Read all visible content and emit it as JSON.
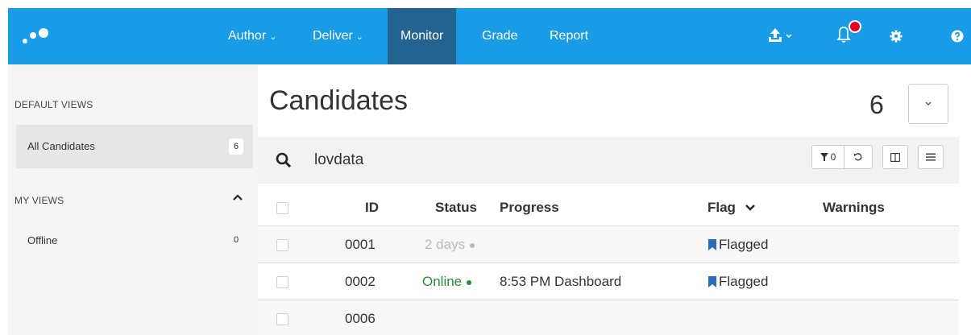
{
  "colors": {
    "brand": "#1a9be6",
    "nav_active": "#24628f",
    "notification": "#e4002b",
    "online": "#2e8b3a",
    "offline_dot": "#bbbbbb",
    "flag": "#2a6ebb"
  },
  "nav": {
    "logo_icon": "dots-logo-icon",
    "items": [
      {
        "label": "Author",
        "has_dropdown": true
      },
      {
        "label": "Deliver",
        "has_dropdown": true
      },
      {
        "label": "Monitor",
        "active": true
      },
      {
        "label": "Grade"
      },
      {
        "label": "Report"
      }
    ],
    "icons": [
      "upload-icon",
      "bell-icon",
      "gear-icon",
      "help-icon"
    ]
  },
  "sidebar": {
    "default_views_heading": "DEFAULT VIEWS",
    "default_views": [
      {
        "label": "All Candidates",
        "count": "6",
        "selected": true
      }
    ],
    "my_views_heading": "MY VIEWS",
    "my_views": [
      {
        "label": "Offline",
        "count": "0"
      }
    ]
  },
  "main": {
    "title": "Candidates",
    "count": "6",
    "search_value": "lovdata",
    "filter_count": "0",
    "columns": [
      "ID",
      "Status",
      "Progress",
      "Flag",
      "Warnings"
    ],
    "rows": [
      {
        "id": "0001",
        "status": "2 days",
        "status_kind": "offline",
        "progress": "",
        "flag": "Flagged"
      },
      {
        "id": "0002",
        "status": "Online",
        "status_kind": "online",
        "progress": "8:53 PM Dashboard",
        "flag": "Flagged"
      },
      {
        "id": "0006",
        "status": "",
        "status_kind": "none",
        "progress": "",
        "flag": ""
      }
    ]
  }
}
